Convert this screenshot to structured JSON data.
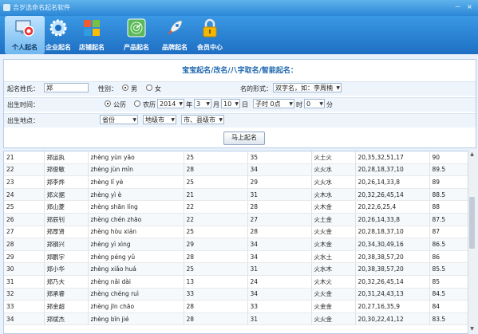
{
  "window": {
    "title": "吉岁选命名起名软件",
    "min_label": "－",
    "close_label": "×"
  },
  "toolbar": [
    {
      "label": "个人起名",
      "icon": "monitor-lifebuoy-icon",
      "active": true
    },
    {
      "label": "企业起名",
      "icon": "gear-icon"
    },
    {
      "label": "店铺起名",
      "icon": "color-blocks-icon"
    },
    {
      "label": "产品起名",
      "icon": "radar-icon"
    },
    {
      "label": "品牌起名",
      "icon": "rocket-icon"
    },
    {
      "label": "会员中心",
      "icon": "padlock-icon"
    }
  ],
  "form": {
    "panel_title": "宝宝起名/改名/八字取名/智能起名：",
    "surname_label": "起名姓氏：",
    "surname_value": "郑",
    "gender_label": "性别：",
    "gender_male": "男",
    "gender_female": "女",
    "gender_selected": "男",
    "name_format_label": "名的形式：",
    "name_format_value": "双字名，如：李周楠",
    "birth_time_label": "出生时间：",
    "calendar_solar": "公历",
    "calendar_lunar": "农历",
    "calendar_selected": "公历",
    "year_value": "2014",
    "year_unit": "年",
    "month_value": "3",
    "month_unit": "月",
    "day_value": "10",
    "day_unit": "日",
    "hour_value": "子时  0点",
    "hour_unit": "时",
    "minute_value": "0",
    "minute_unit": "分",
    "birth_place_label": "出生地点：",
    "province_value": "省份",
    "city_value": "地级市",
    "county_value": "市、县级市",
    "submit_label": "马上起名"
  },
  "results": {
    "rows": [
      [
        "21",
        "郑运执",
        "zhèng yùn yǎo",
        "25",
        "35",
        "火土火",
        "20,35,32,51,17",
        "90"
      ],
      [
        "22",
        "郑俊敏",
        "zhèng jùn mǐn",
        "28",
        "34",
        "火火水",
        "20,28,18,37,10",
        "89.5"
      ],
      [
        "23",
        "郑李烨",
        "zhèng lǐ yè",
        "25",
        "29",
        "火火水",
        "20,26,14,33,8",
        "89"
      ],
      [
        "24",
        "郑义据",
        "zhèng yì è",
        "21",
        "31",
        "火木水",
        "20,32,26,45,14",
        "88.5"
      ],
      [
        "25",
        "郑山菱",
        "zhèng shān líng",
        "22",
        "28",
        "火木金",
        "20,22,6,25,4",
        "88"
      ],
      [
        "26",
        "郑辰钊",
        "zhèng chén zhāo",
        "22",
        "27",
        "火土金",
        "20,26,14,33,8",
        "87.5"
      ],
      [
        "27",
        "郑厚贤",
        "zhèng hòu xián",
        "25",
        "28",
        "火火金",
        "20,28,18,37,10",
        "87"
      ],
      [
        "28",
        "郑钢兴",
        "zhèng yì xìng",
        "29",
        "34",
        "火木金",
        "20,34,30,49,16",
        "86.5"
      ],
      [
        "29",
        "郑鹏宇",
        "zhèng péng yǔ",
        "28",
        "34",
        "火水土",
        "20,38,38,57,20",
        "86"
      ],
      [
        "30",
        "郑小华",
        "zhèng xiǎo huá",
        "25",
        "31",
        "火水木",
        "20,38,38,57,20",
        "85.5"
      ],
      [
        "31",
        "郑乃大",
        "zhèng nǎi dài",
        "13",
        "24",
        "火木火",
        "20,32,26,45,14",
        "85"
      ],
      [
        "32",
        "郑承睿",
        "zhèng chéng ruì",
        "33",
        "34",
        "火火金",
        "20,31,24,43,13",
        "84.5"
      ],
      [
        "33",
        "郑金超",
        "zhèng jīn chāo",
        "28",
        "33",
        "火金金",
        "20,27,16,35,9",
        "84"
      ],
      [
        "34",
        "郑斌杰",
        "zhèng bīn jié",
        "28",
        "31",
        "火火金",
        "20,30,22,41,12",
        "83.5"
      ]
    ]
  }
}
